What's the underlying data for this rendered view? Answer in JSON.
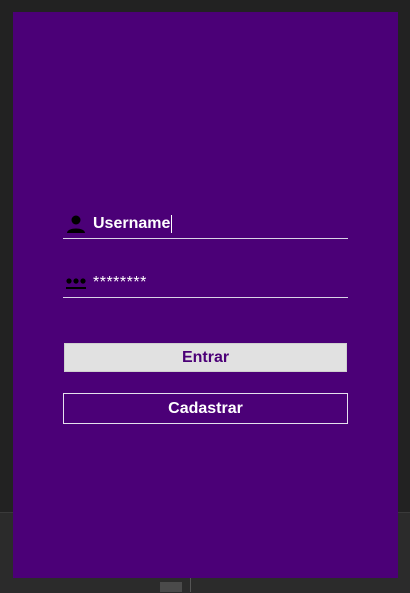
{
  "login": {
    "username_value": "Username",
    "password_mask": "********",
    "login_label": "Entrar",
    "register_label": "Cadastrar"
  },
  "icons": {
    "username": "user-icon",
    "password": "password-dots-icon"
  },
  "colors": {
    "background": "#4b0077",
    "primary_button_bg": "#e1e1e1",
    "primary_button_text": "#4b0077",
    "text": "#ffffff"
  }
}
